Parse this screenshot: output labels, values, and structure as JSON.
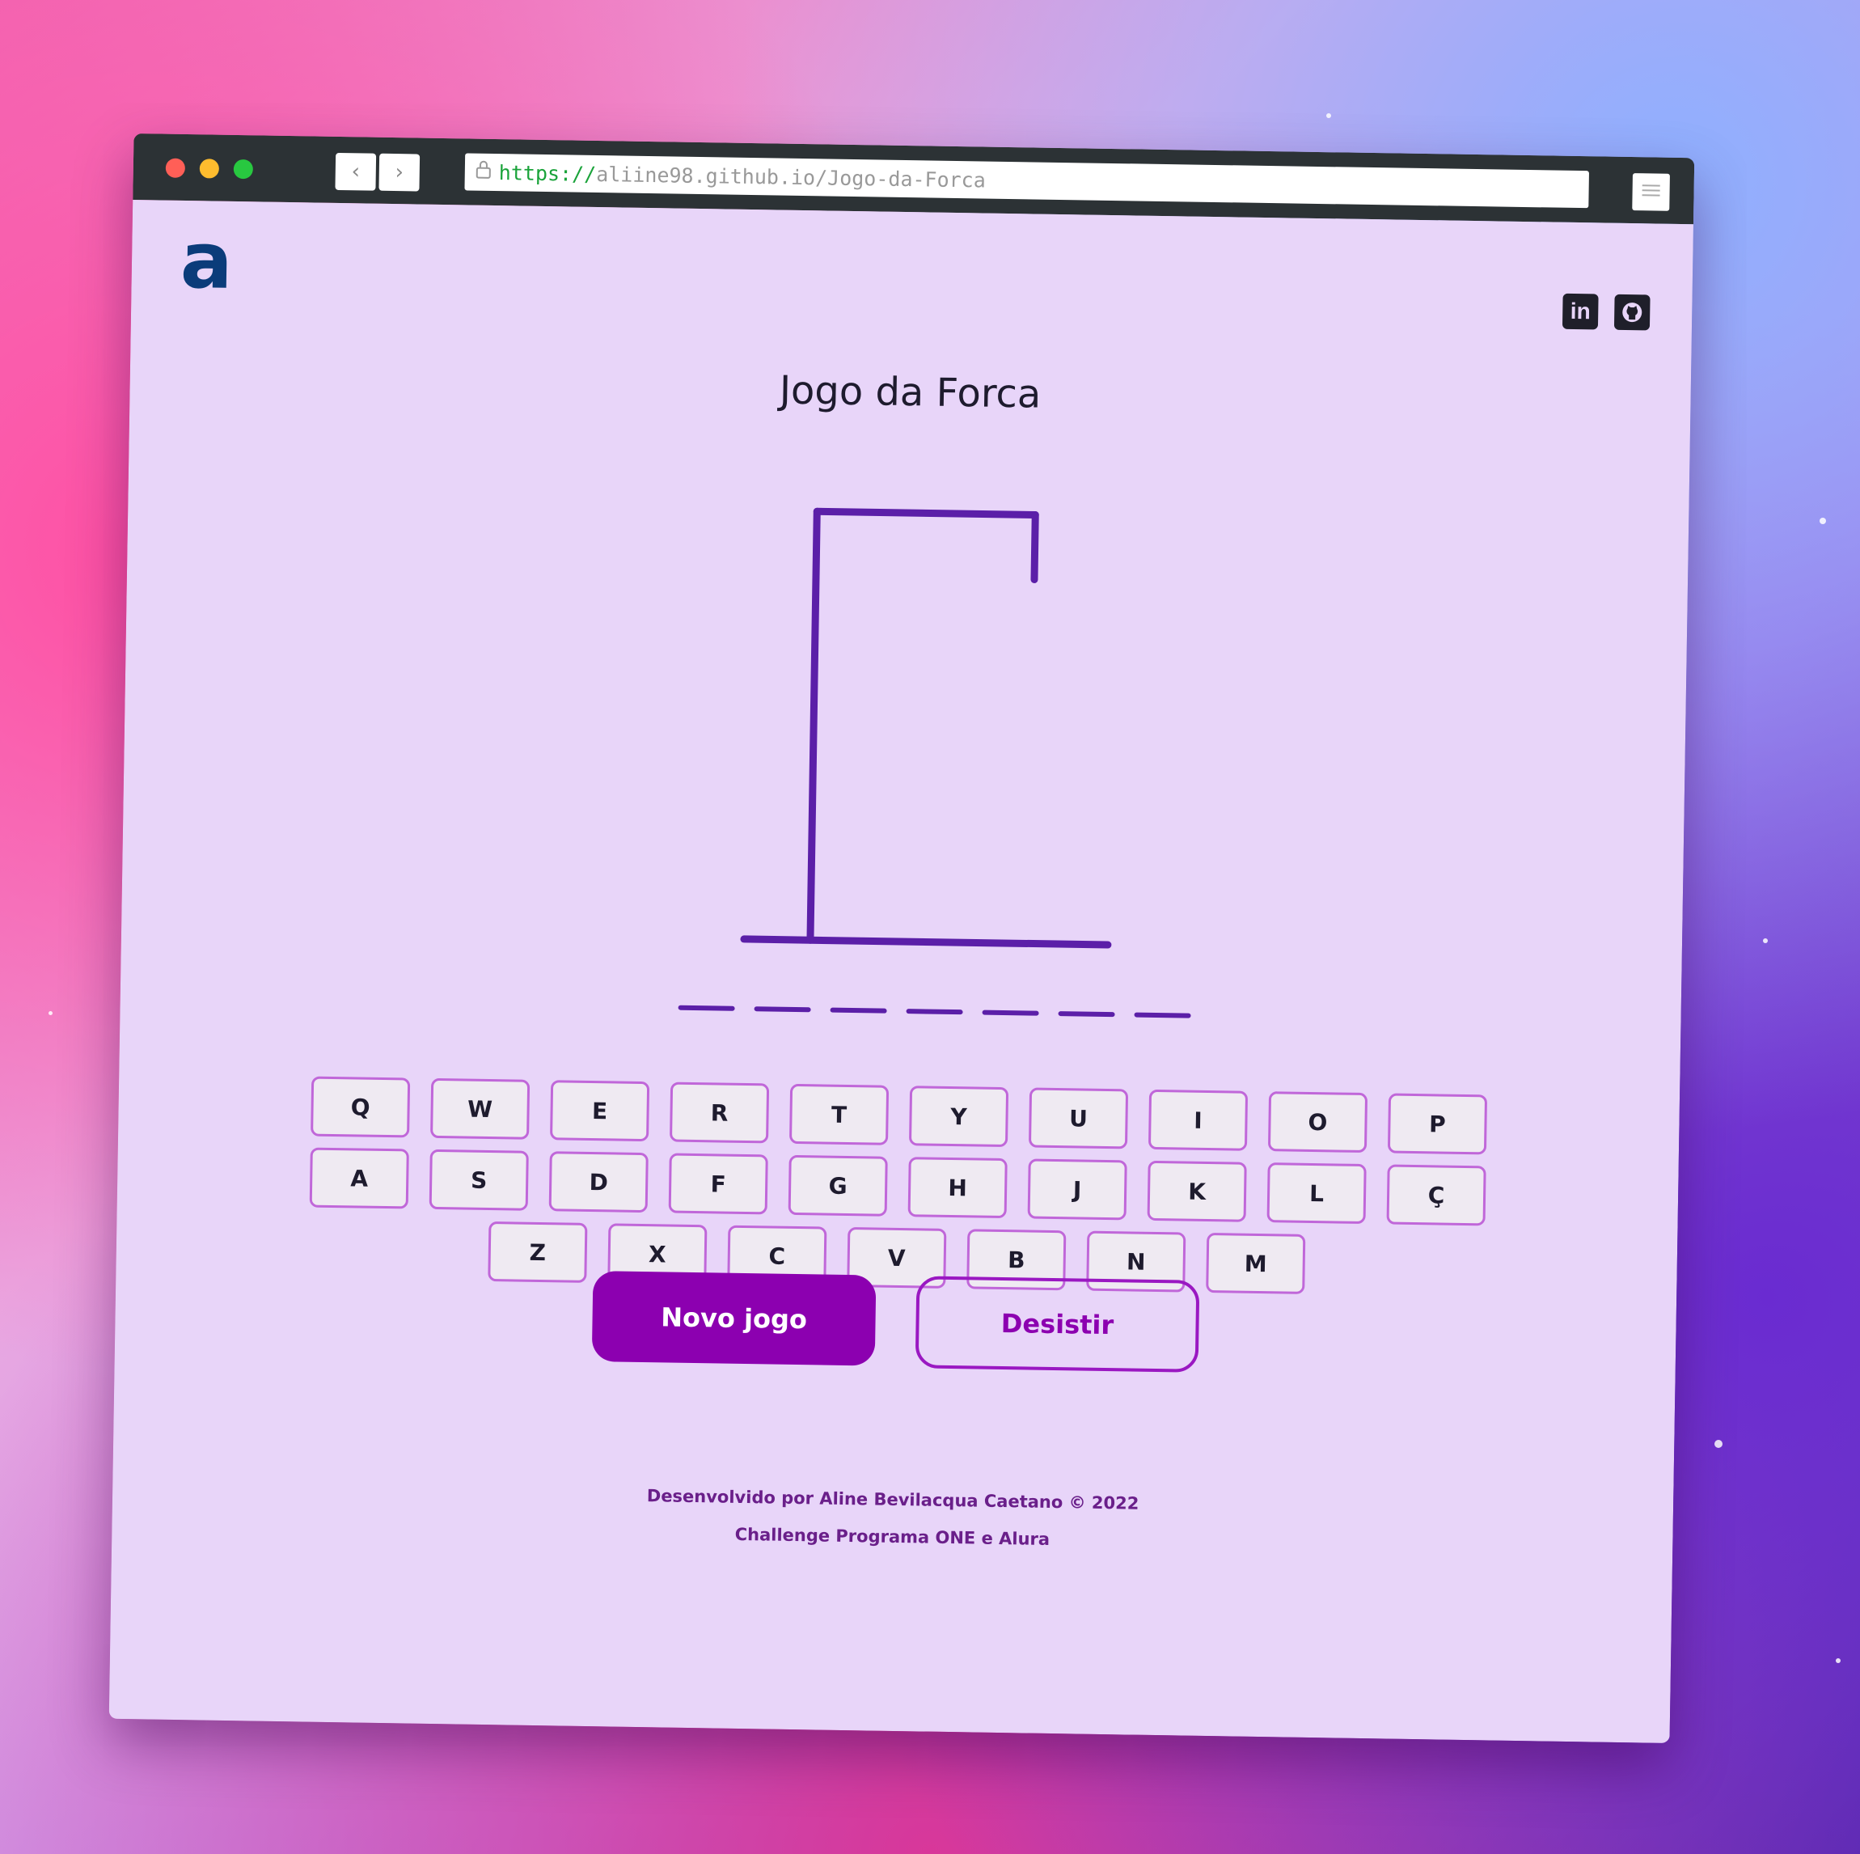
{
  "browser": {
    "url_scheme": "https://",
    "url_rest": "aliine98.github.io/Jogo-da-Forca",
    "back_symbol": "‹",
    "forward_symbol": "›"
  },
  "header": {
    "logo_text": "a",
    "social": [
      {
        "label": "in",
        "icon": "linkedin-icon"
      },
      {
        "label": "",
        "icon": "github-icon"
      }
    ]
  },
  "main": {
    "title": "Jogo da Forca",
    "word_blanks": 7,
    "keyboard_rows": [
      [
        "Q",
        "W",
        "E",
        "R",
        "T",
        "Y",
        "U",
        "I",
        "O",
        "P"
      ],
      [
        "A",
        "S",
        "D",
        "F",
        "G",
        "H",
        "J",
        "K",
        "L",
        "Ç"
      ],
      [
        "Z",
        "X",
        "C",
        "V",
        "B",
        "N",
        "M"
      ]
    ],
    "new_game_label": "Novo jogo",
    "give_up_label": "Desistir"
  },
  "footer": {
    "line1": "Desenvolvido por Aline Bevilacqua Caetano © 2022",
    "line2": "Challenge Programa ONE e Alura"
  },
  "colors": {
    "page_bg": "#e8d5f9",
    "accent": "#8c00b0",
    "gallows": "#5b1fa8",
    "logo": "#0b3c7a"
  }
}
